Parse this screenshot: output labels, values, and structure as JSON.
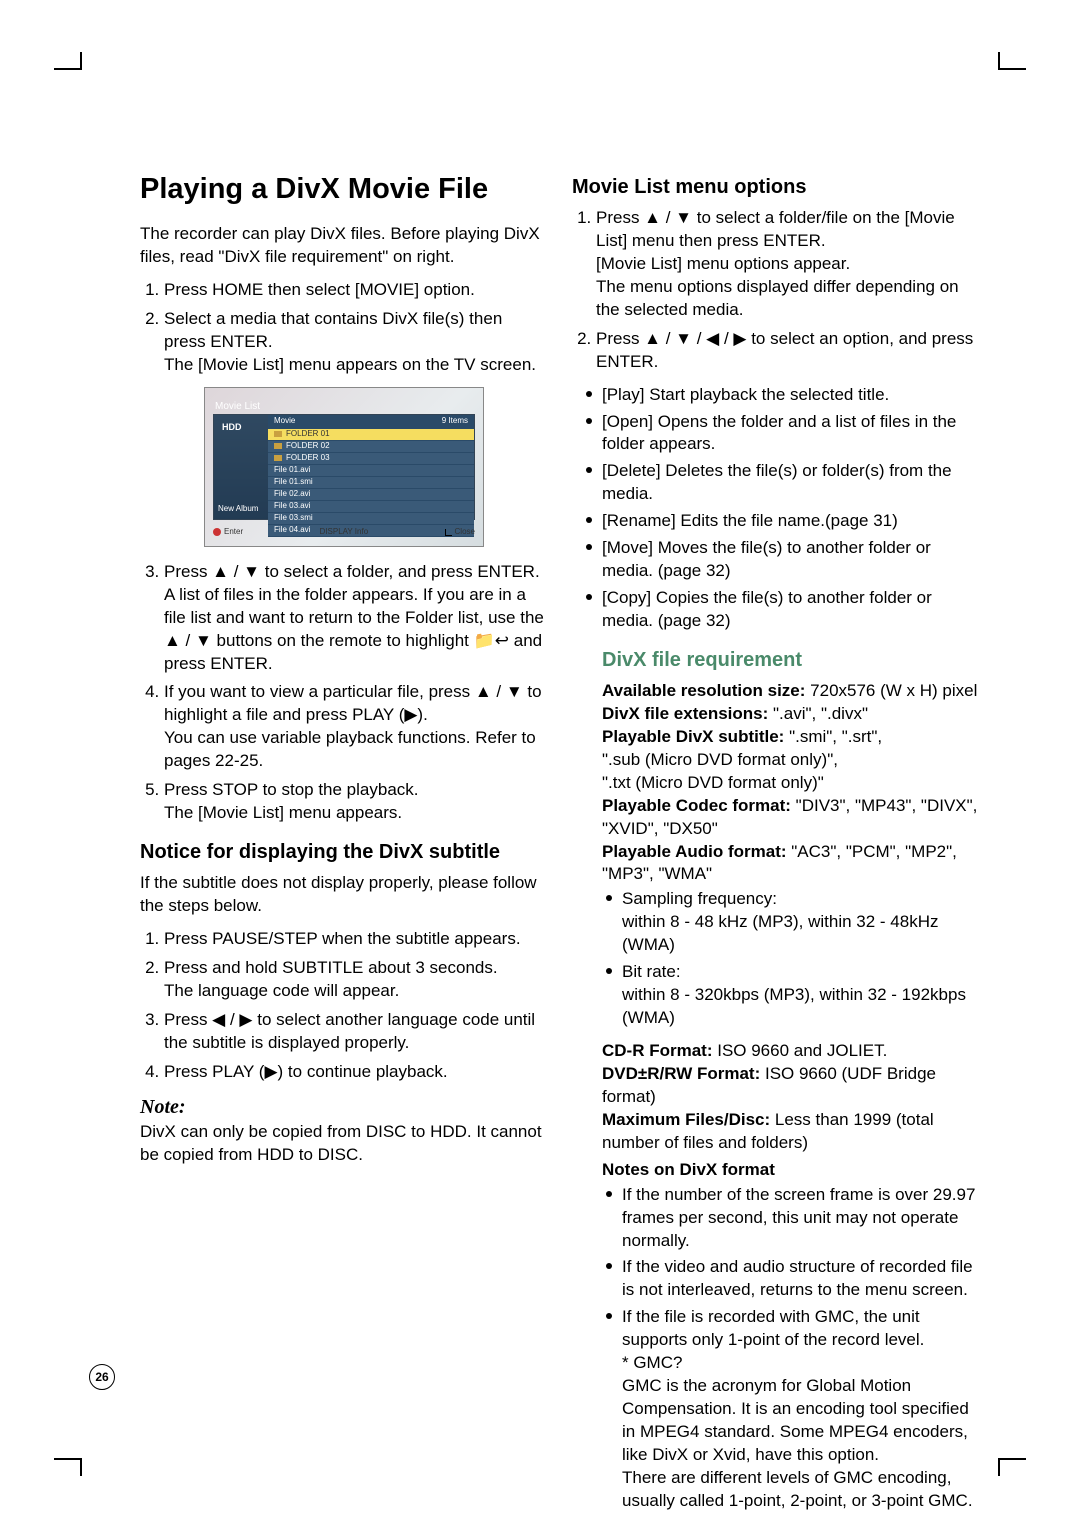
{
  "page_number": "26",
  "left": {
    "h1": "Playing a DivX Movie File",
    "intro": "The recorder can play DivX files. Before playing DivX files, read \"DivX file requirement\" on right.",
    "steps": [
      "Press HOME then select [MOVIE] option.",
      "Select a media that contains DivX file(s) then press ENTER.\nThe [Movie List] menu appears on the TV screen.",
      "Press ▲ / ▼ to select a folder, and press ENTER. A list of files in the folder appears. If you are in a file list and want to return to the Folder list, use the ▲ / ▼ buttons on the remote to highlight  📁↩  and press ENTER.",
      "If you want to view a particular file, press ▲ / ▼ to highlight a file and press PLAY (▶).\nYou can use variable playback functions. Refer to pages 22-25.",
      "Press STOP to stop the playback.\nThe [Movie List] menu appears."
    ],
    "h2_subtitle": "Notice for displaying the DivX subtitle",
    "subtitle_intro": "If the subtitle does not display properly, please follow the steps below.",
    "subtitle_steps": [
      "Press PAUSE/STEP when the subtitle appears.",
      "Press and hold SUBTITLE about 3 seconds.\nThe language code will appear.",
      "Press ◀ / ▶ to select another language code until the subtitle is displayed properly.",
      "Press PLAY (▶) to continue playback."
    ],
    "note_label": "Note:",
    "note_body": "DivX can only be copied from DISC to HDD. It cannot be copied from HDD to DISC."
  },
  "right": {
    "h2_menu": "Movie List menu options",
    "menu_steps": [
      "Press ▲ / ▼ to select a folder/file on the [Movie List] menu then press ENTER.\n[Movie List] menu options appear.\nThe menu options displayed differ depending on the selected media.",
      "Press ▲ / ▼ / ◀ / ▶ to select an option, and press ENTER."
    ],
    "menu_opts": [
      "[Play] Start playback the selected title.",
      "[Open] Opens the folder and a list of files in the folder appears.",
      "[Delete] Deletes the file(s) or folder(s) from the media.",
      "[Rename] Edits the file name.(page 31)",
      "[Move] Moves the file(s) to another folder or media. (page 32)",
      "[Copy] Copies the file(s) to another folder or media. (page 32)"
    ],
    "h2_req": "DivX file requirement",
    "req": [
      {
        "b": "Available resolution size:",
        "t": " 720x576 (W x H) pixel"
      },
      {
        "b": "DivX file extensions:",
        "t": " \".avi\", \".divx\""
      },
      {
        "b": "Playable DivX subtitle:",
        "t": " \".smi\", \".srt\","
      },
      {
        "b": "",
        "t": "\".sub (Micro DVD format only)\","
      },
      {
        "b": "",
        "t": "\".txt (Micro DVD format only)\""
      },
      {
        "b": "Playable Codec format:",
        "t": " \"DIV3\", \"MP43\", \"DIVX\", \"XVID\", \"DX50\""
      },
      {
        "b": "Playable Audio format:",
        "t": " \"AC3\", \"PCM\", \"MP2\", \"MP3\", \"WMA\""
      }
    ],
    "audio_bul": [
      "Sampling frequency:\nwithin 8 - 48 kHz (MP3), within 32 - 48kHz (WMA)",
      "Bit rate:\nwithin 8 - 320kbps (MP3), within 32 - 192kbps (WMA)"
    ],
    "req2": [
      {
        "b": "CD-R Format:",
        "t": " ISO 9660 and JOLIET."
      },
      {
        "b": "DVD±R/RW Format:",
        "t": " ISO 9660 (UDF Bridge format)"
      },
      {
        "b": "Maximum Files/Disc:",
        "t": " Less than 1999 (total number of files and folders)"
      }
    ],
    "notes_hdr": "Notes on DivX format",
    "notes": [
      "If the number of the screen frame is over 29.97 frames per second, this unit may not operate normally.",
      "If the video and audio structure of recorded file is not interleaved, returns to the menu screen.",
      "If the file is recorded with GMC, the unit supports only 1-point of the record level.\n* GMC?\nGMC is the acronym for Global Motion Compensation. It is an encoding tool specified in MPEG4 standard. Some MPEG4 encoders, like DivX or Xvid, have this option.\nThere are different levels of GMC encoding, usually called 1-point, 2-point, or 3-point GMC."
    ]
  },
  "screenshot": {
    "title": "Movie List",
    "side_label": "HDD",
    "new_album": "New Album",
    "hdr_left": "Movie",
    "hdr_right": "9 Items",
    "rows": [
      "FOLDER 01",
      "FOLDER 02",
      "FOLDER 03",
      "File 01.avi",
      "File 01.smi",
      "File 02.avi",
      "File 03.avi",
      "File 03.smi",
      "File 04.avi"
    ],
    "ft_enter": "Enter",
    "ft_info": "DISPLAY  Info",
    "ft_close": "Close"
  }
}
